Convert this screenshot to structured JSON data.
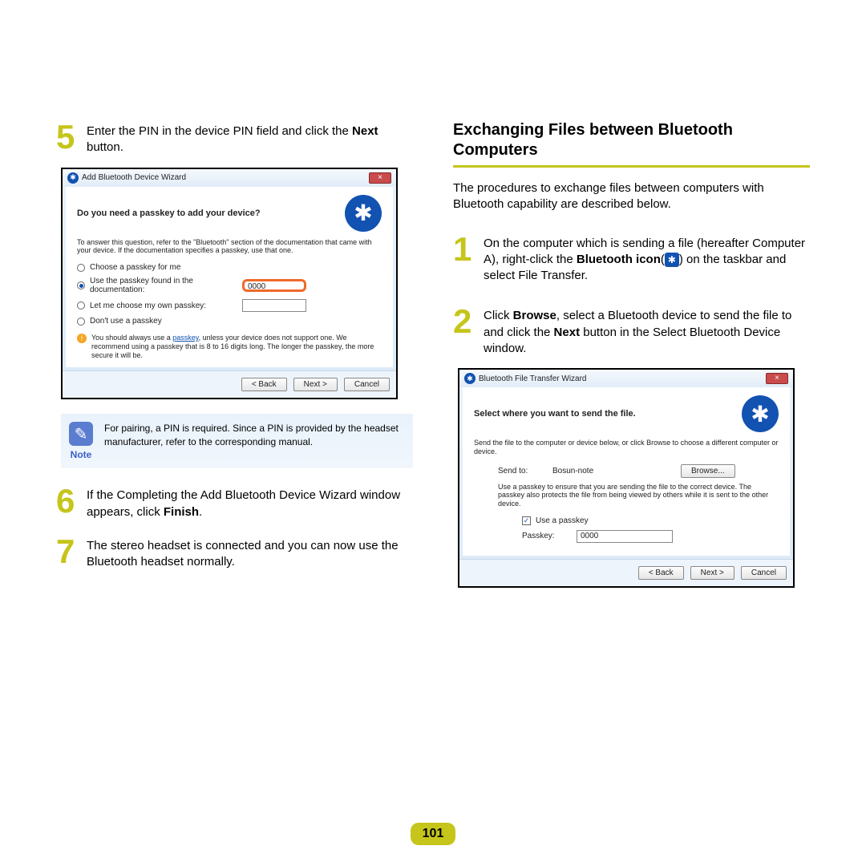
{
  "page_number": "101",
  "left": {
    "step5": {
      "num": "5",
      "text_a": "Enter the PIN in the device PIN field and click the ",
      "text_b": "Next",
      "text_c": " button."
    },
    "dialog1": {
      "title": "Add Bluetooth Device Wizard",
      "heading": "Do you need a passkey to add your device?",
      "help": "To answer this question, refer to the \"Bluetooth\" section of the documentation that came with your device. If the documentation specifies a passkey, use that one.",
      "opt1": "Choose a passkey for me",
      "opt2": "Use the passkey found in the documentation:",
      "opt2_value": "0000",
      "opt3": "Let me choose my own passkey:",
      "opt4": "Don't use a passkey",
      "warn_a": "You should always use a ",
      "warn_link": "passkey",
      "warn_b": ", unless your device does not support one. We recommend using a passkey that is 8 to 16 digits long. The longer the passkey, the more secure it will be.",
      "back": "< Back",
      "next": "Next >",
      "cancel": "Cancel"
    },
    "note": {
      "label": "Note",
      "text": "For pairing, a PIN is required. Since a PIN is provided by the headset manufacturer, refer to the corresponding manual."
    },
    "step6": {
      "num": "6",
      "text_a": "If the Completing the Add Bluetooth Device Wizard window appears, click ",
      "text_b": "Finish",
      "text_c": "."
    },
    "step7": {
      "num": "7",
      "text": "The stereo headset is connected and you can now use the Bluetooth headset normally."
    }
  },
  "right": {
    "heading": "Exchanging Files between Bluetooth Computers",
    "intro": "The procedures to exchange files between computers with Bluetooth capability are described below.",
    "step1": {
      "num": "1",
      "text_a": "On the computer which is sending a file (hereafter Computer A), right-click the ",
      "text_b": "Bluetooth icon",
      "text_c": "(",
      "text_d": ") on the taskbar and select File Transfer."
    },
    "step2": {
      "num": "2",
      "text_a": "Click ",
      "text_b": "Browse",
      "text_c": ", select a Bluetooth device to send the file to and click the ",
      "text_d": "Next",
      "text_e": " button in the Select Bluetooth Device window."
    },
    "dialog2": {
      "title": "Bluetooth File Transfer Wizard",
      "heading": "Select where you want to send the file.",
      "help": "Send the file to the computer or device below, or click Browse to choose a different computer or device.",
      "sendto_label": "Send to:",
      "sendto_value": "Bosun-note",
      "browse": "Browse...",
      "passkey_help": "Use a passkey to ensure that you are sending the file to the correct device. The passkey also protects the file from being viewed by others while it is sent to the other device.",
      "use_passkey": "Use a passkey",
      "passkey_label": "Passkey:",
      "passkey_value": "0000",
      "back": "< Back",
      "next": "Next >",
      "cancel": "Cancel"
    }
  }
}
